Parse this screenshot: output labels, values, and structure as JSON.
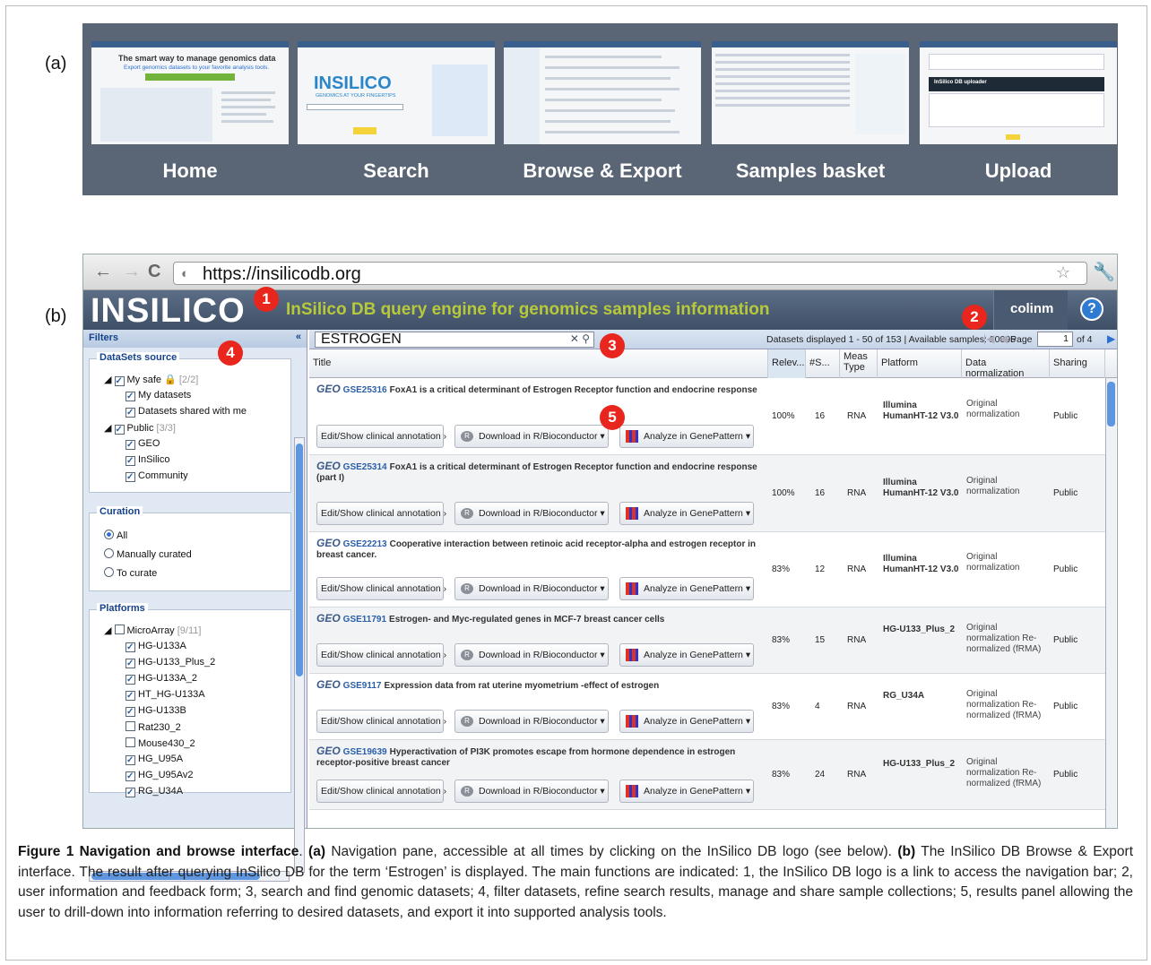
{
  "panel_labels": {
    "a": "(a)",
    "b": "(b)"
  },
  "nav_pane": {
    "items": [
      {
        "label": "Home"
      },
      {
        "label": "Search"
      },
      {
        "label": "Browse & Export"
      },
      {
        "label": "Samples basket"
      },
      {
        "label": "Upload"
      }
    ]
  },
  "thumbs": {
    "home_headline": "The smart way to manage genomics data",
    "home_sub": "Export genomics datasets to your favorite analysis tools.",
    "search_logo": "INSILICO",
    "search_tagline": "GENOMICS AT YOUR FINGERTIPS",
    "upload_title": "InSilico DB uploader"
  },
  "browser": {
    "url": "https://insilicodb.org",
    "back": "←",
    "forward": "→",
    "reload": "C",
    "star": "☆",
    "wrench": "🔧"
  },
  "app": {
    "logo": "INSILICO",
    "tagline": "InSilico DB query engine for genomics samples information",
    "user": "colinm",
    "help": "?"
  },
  "badges": [
    "1",
    "2",
    "3",
    "4",
    "5"
  ],
  "filters": {
    "header": "Filters",
    "collapse": "«",
    "datasets_source": {
      "title": "DataSets source",
      "my_safe": "My safe",
      "my_safe_count": "[2/2]",
      "my_datasets": "My datasets",
      "shared": "Datasets shared with me",
      "public": "Public",
      "public_count": "[3/3]",
      "geo": "GEO",
      "insilico": "InSilico",
      "community": "Community"
    },
    "curation": {
      "title": "Curation",
      "all": "All",
      "manual": "Manually curated",
      "to_curate": "To curate"
    },
    "platforms": {
      "title": "Platforms",
      "microarray": "MicroArray",
      "microarray_count": "[9/11]",
      "items": [
        {
          "label": "HG-U133A",
          "checked": true
        },
        {
          "label": "HG-U133_Plus_2",
          "checked": true
        },
        {
          "label": "HG-U133A_2",
          "checked": true
        },
        {
          "label": "HT_HG-U133A",
          "checked": true
        },
        {
          "label": "HG-U133B",
          "checked": true
        },
        {
          "label": "Rat230_2",
          "checked": false
        },
        {
          "label": "Mouse430_2",
          "checked": false
        },
        {
          "label": "HG_U95A",
          "checked": true
        },
        {
          "label": "HG_U95Av2",
          "checked": true
        },
        {
          "label": "RG_U34A",
          "checked": true
        }
      ]
    }
  },
  "results": {
    "search_value": "ESTROGEN",
    "info": "Datasets displayed 1 - 50 of 153 | Available samples: 20095",
    "page_label": "Page",
    "page_value": "1",
    "page_of": "of 4",
    "columns": {
      "title": "Title",
      "relev": "Relev...",
      "samples": "#S...",
      "meas": "Meas Type",
      "platform": "Platform",
      "norm": "Data normalization",
      "sharing": "Sharing"
    },
    "buttons": {
      "annot": "Edit/Show clinical annotation ›",
      "download": "Download in R/Bioconductor",
      "analyze": "Analyze in GenePattern",
      "r_icon": "R"
    },
    "geo_tag": "GEO",
    "rows": [
      {
        "acc": "GSE25316",
        "title": "FoxA1 is a critical determinant of Estrogen Receptor function and endocrine response",
        "relev": "100%",
        "samples": "16",
        "meas": "RNA",
        "platform": "Illumina HumanHT-12 V3.0",
        "norm": "Original normalization",
        "sharing": "Public"
      },
      {
        "acc": "GSE25314",
        "title": "FoxA1 is a critical determinant of Estrogen Receptor function and endocrine response (part I)",
        "relev": "100%",
        "samples": "16",
        "meas": "RNA",
        "platform": "Illumina HumanHT-12 V3.0",
        "norm": "Original normalization",
        "sharing": "Public"
      },
      {
        "acc": "GSE22213",
        "title": "Cooperative interaction between retinoic acid receptor-alpha and estrogen receptor in breast cancer.",
        "relev": "83%",
        "samples": "12",
        "meas": "RNA",
        "platform": "Illumina HumanHT-12 V3.0",
        "norm": "Original normalization",
        "sharing": "Public"
      },
      {
        "acc": "GSE11791",
        "title": "Estrogen- and Myc-regulated genes in MCF-7 breast cancer cells",
        "relev": "83%",
        "samples": "15",
        "meas": "RNA",
        "platform": "HG-U133_Plus_2",
        "norm": "Original normalization Re-normalized (fRMA)",
        "sharing": "Public"
      },
      {
        "acc": "GSE9117",
        "title": "Expression data from rat uterine myometrium -effect of estrogen",
        "relev": "83%",
        "samples": "4",
        "meas": "RNA",
        "platform": "RG_U34A",
        "norm": "Original normalization Re-normalized (fRMA)",
        "sharing": "Public"
      },
      {
        "acc": "GSE19639",
        "title": "Hyperactivation of PI3K promotes escape from hormone dependence in estrogen receptor-positive breast cancer",
        "relev": "83%",
        "samples": "24",
        "meas": "RNA",
        "platform": "HG-U133_Plus_2",
        "norm": "Original normalization Re-normalized (fRMA)",
        "sharing": "Public"
      }
    ]
  },
  "caption": {
    "fig": "Figure 1 Navigation and browse interface",
    "a_label": "(a)",
    "a_text": "Navigation pane, accessible at all times by clicking on the InSilico DB logo (see below).",
    "b_label": "(b)",
    "b_text": "The InSilico DB Browse & Export interface. The result after querying InSilico DB for the term ‘Estrogen’ is displayed. The main functions are indicated: 1, the InSilico DB logo is a link to access the navigation bar; 2, user information and feedback form; 3, search and find genomic datasets; 4, filter datasets, refine search results, manage and share sample collections; 5, results panel allowing the user to drill-down into information referring to desired datasets, and export it into supported analysis tools."
  }
}
